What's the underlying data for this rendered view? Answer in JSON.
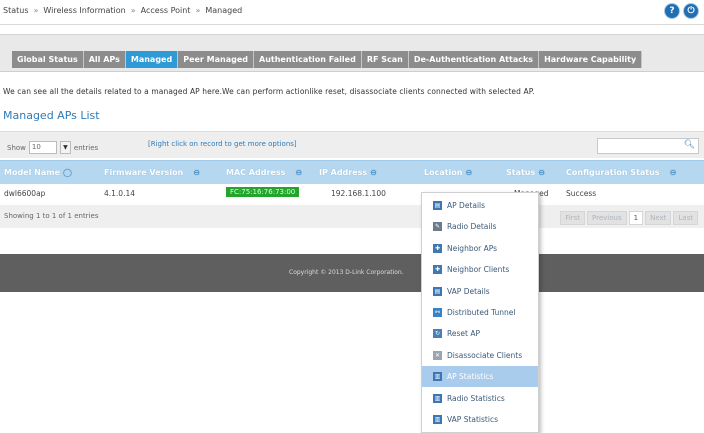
{
  "breadcrumb": [
    "Status",
    "Wireless Information",
    "Access Point",
    "Managed"
  ],
  "breadcrumb_sep": "»",
  "tabs": [
    {
      "label": "Global Status",
      "active": false
    },
    {
      "label": "All APs",
      "active": false
    },
    {
      "label": "Managed",
      "active": true
    },
    {
      "label": "Peer Managed",
      "active": false
    },
    {
      "label": "Authentication Failed",
      "active": false
    },
    {
      "label": "RF Scan",
      "active": false
    },
    {
      "label": "De-Authentication Attacks",
      "active": false
    },
    {
      "label": "Hardware Capability",
      "active": false
    }
  ],
  "description": "We can see all the details related to a managed AP here.We can perform actionlike reset, disassociate clients connected with selected AP.",
  "list_title": "Managed APs List",
  "toolbar": {
    "show_label": "Show",
    "entries_value": "10",
    "entries_label": "entries",
    "hint": "[Right click on record to get more options]",
    "search_value": ""
  },
  "columns": [
    "Model Name",
    "Firmware Version",
    "MAC Address",
    "IP Address",
    "Location",
    "Status",
    "Configuration Status"
  ],
  "rows": [
    {
      "model": "dwl6600ap",
      "firmware": "4.1.0.14",
      "mac": "FC:75:16:76:73:00",
      "ip": "192.168.1.100",
      "location": "",
      "status": "Managed",
      "config": "Success"
    }
  ],
  "info": "Showing 1 to 1 of 1 entries",
  "pager": {
    "first": "First",
    "prev": "Previous",
    "page": "1",
    "next": "Next",
    "last": "Last"
  },
  "footer": "Copyright © 2013 D-Link Corporation.",
  "context_menu": [
    {
      "label": "AP Details",
      "icon": "details-icon",
      "color": "#3c76b5",
      "highlight": false
    },
    {
      "label": "Radio Details",
      "icon": "edit-icon",
      "color": "#6b7b8b",
      "highlight": false
    },
    {
      "label": "Neighbor APs",
      "icon": "network-icon",
      "color": "#3f78b2",
      "highlight": false
    },
    {
      "label": "Neighbor Clients",
      "icon": "network-icon",
      "color": "#3f78b2",
      "highlight": false
    },
    {
      "label": "VAP Details",
      "icon": "details-icon",
      "color": "#3c76b5",
      "highlight": false
    },
    {
      "label": "Distributed Tunnel",
      "icon": "tunnel-icon",
      "color": "#3a82c8",
      "highlight": false
    },
    {
      "label": "Reset AP",
      "icon": "reset-icon",
      "color": "#4a7fb5",
      "highlight": false
    },
    {
      "label": "Disassociate Clients",
      "icon": "disconnect-icon",
      "color": "#9aa5b0",
      "highlight": false
    },
    {
      "label": "AP Statistics",
      "icon": "stats-icon",
      "color": "#3c76b5",
      "highlight": true
    },
    {
      "label": "Radio Statistics",
      "icon": "stats-icon",
      "color": "#3c76b5",
      "highlight": false
    },
    {
      "label": "VAP Statistics",
      "icon": "stats-icon",
      "color": "#3c76b5",
      "highlight": false
    }
  ]
}
